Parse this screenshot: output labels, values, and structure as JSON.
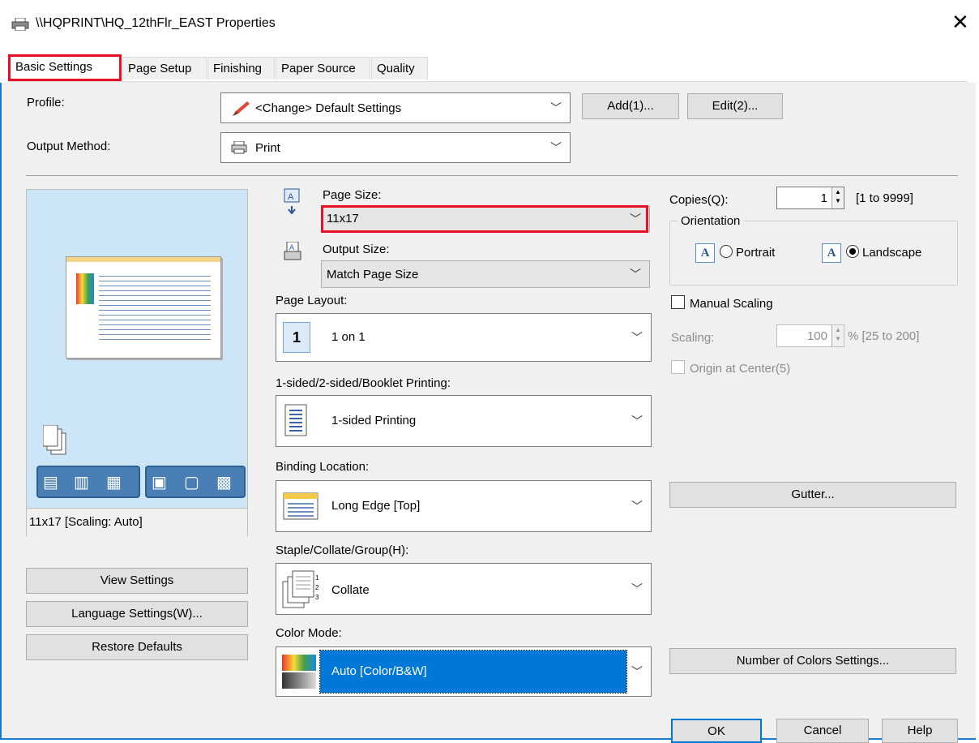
{
  "window": {
    "title": "\\\\HQPRINT\\HQ_12thFlr_EAST Properties",
    "close_symbol": "✕"
  },
  "tabs": [
    {
      "label": "Basic Settings"
    },
    {
      "label": "Page Setup"
    },
    {
      "label": "Finishing"
    },
    {
      "label": "Paper Source"
    },
    {
      "label": "Quality"
    }
  ],
  "profile": {
    "label": "Profile:",
    "value": "<Change> Default Settings",
    "add_label": "Add(1)...",
    "edit_label": "Edit(2)..."
  },
  "output_method": {
    "label": "Output Method:",
    "value": "Print"
  },
  "preview": {
    "caption": "11x17 [Scaling: Auto]"
  },
  "left_buttons": {
    "view": "View Settings",
    "language": "Language Settings(W)...",
    "restore": "Restore Defaults"
  },
  "page_size": {
    "label": "Page Size:",
    "value": "11x17"
  },
  "output_size": {
    "label": "Output Size:",
    "value": "Match Page Size"
  },
  "page_layout": {
    "label": "Page Layout:",
    "value": "1 on 1",
    "icon_digit": "1"
  },
  "sided": {
    "label": "1-sided/2-sided/Booklet Printing:",
    "value": "1-sided Printing"
  },
  "binding": {
    "label": "Binding Location:",
    "value": "Long Edge [Top]"
  },
  "staple": {
    "label": "Staple/Collate/Group(H):",
    "value": "Collate"
  },
  "color_mode": {
    "label": "Color Mode:",
    "value": "Auto [Color/B&W]"
  },
  "copies": {
    "label": "Copies(Q):",
    "value": "1",
    "range": "[1 to 9999]"
  },
  "orientation": {
    "group_label": "Orientation",
    "portrait": "Portrait",
    "landscape": "Landscape",
    "selected": "Landscape",
    "icon_letter": "A"
  },
  "manual_scaling": {
    "label": "Manual Scaling",
    "checked": false
  },
  "scaling": {
    "label": "Scaling:",
    "value": "100",
    "range": "% [25 to 200]"
  },
  "origin_center": {
    "label": "Origin at Center(5)",
    "checked": false
  },
  "gutter_button": "Gutter...",
  "colors_button": "Number of Colors Settings...",
  "footer": {
    "ok": "OK",
    "cancel": "Cancel",
    "help": "Help"
  },
  "colors": {
    "highlight_red": "#e81123",
    "selection_blue": "#0078d7",
    "accent_blue": "#1979ca"
  }
}
